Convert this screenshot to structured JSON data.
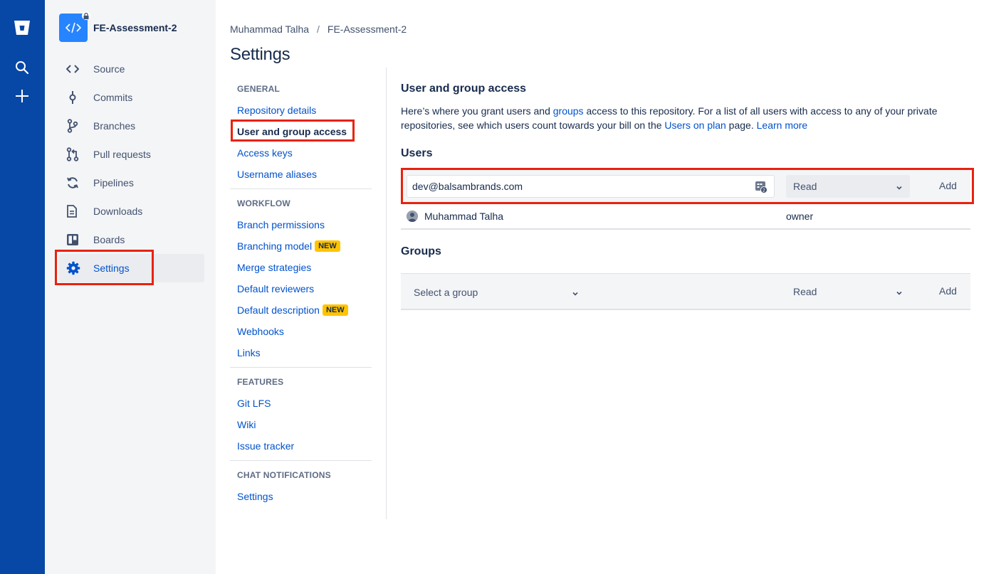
{
  "global_nav": {
    "icons": [
      "bitbucket-logo-icon",
      "search-icon",
      "plus-icon"
    ]
  },
  "sidebar": {
    "repo_name": "FE-Assessment-2",
    "items": [
      {
        "label": "Source",
        "icon": "code-icon"
      },
      {
        "label": "Commits",
        "icon": "commit-icon"
      },
      {
        "label": "Branches",
        "icon": "branch-icon"
      },
      {
        "label": "Pull requests",
        "icon": "pull-request-icon"
      },
      {
        "label": "Pipelines",
        "icon": "pipelines-icon"
      },
      {
        "label": "Downloads",
        "icon": "document-icon"
      },
      {
        "label": "Boards",
        "icon": "board-icon"
      },
      {
        "label": "Settings",
        "icon": "gear-icon",
        "active": true
      }
    ]
  },
  "breadcrumb": {
    "owner": "Muhammad Talha",
    "separator": "/",
    "repo": "FE-Assessment-2"
  },
  "page_title": "Settings",
  "settings_nav": {
    "general": {
      "heading": "GENERAL",
      "links": [
        "Repository details",
        "User and group access",
        "Access keys",
        "Username aliases"
      ]
    },
    "workflow": {
      "heading": "WORKFLOW",
      "links": [
        "Branch permissions",
        "Branching model",
        "Merge strategies",
        "Default reviewers",
        "Default description",
        "Webhooks",
        "Links"
      ],
      "new_badge": "NEW"
    },
    "features": {
      "heading": "FEATURES",
      "links": [
        "Git LFS",
        "Wiki",
        "Issue tracker"
      ]
    },
    "chat": {
      "heading": "CHAT NOTIFICATIONS",
      "links": [
        "Settings"
      ]
    }
  },
  "access": {
    "title": "User and group access",
    "desc_1": "Here’s where you grant users and ",
    "desc_link_groups": "groups",
    "desc_2": " access to this repository. For a list of all users with access to any of your private repositories, see which users count towards your bill on the ",
    "desc_link_users_on_plan": "Users on plan",
    "desc_3": " page. ",
    "desc_link_learn_more": "Learn more",
    "users_heading": "Users",
    "user_input_value": "dev@balsambrands.com",
    "user_permission": "Read",
    "add_label": "Add",
    "user_rows": [
      {
        "name": "Muhammad Talha",
        "role": "owner"
      }
    ],
    "groups_heading": "Groups",
    "group_select_placeholder": "Select a group",
    "group_permission": "Read"
  },
  "colors": {
    "global_nav": "#0747A6",
    "link": "#0052CC",
    "highlight": "#E8220E",
    "badge": "#FFC400"
  }
}
